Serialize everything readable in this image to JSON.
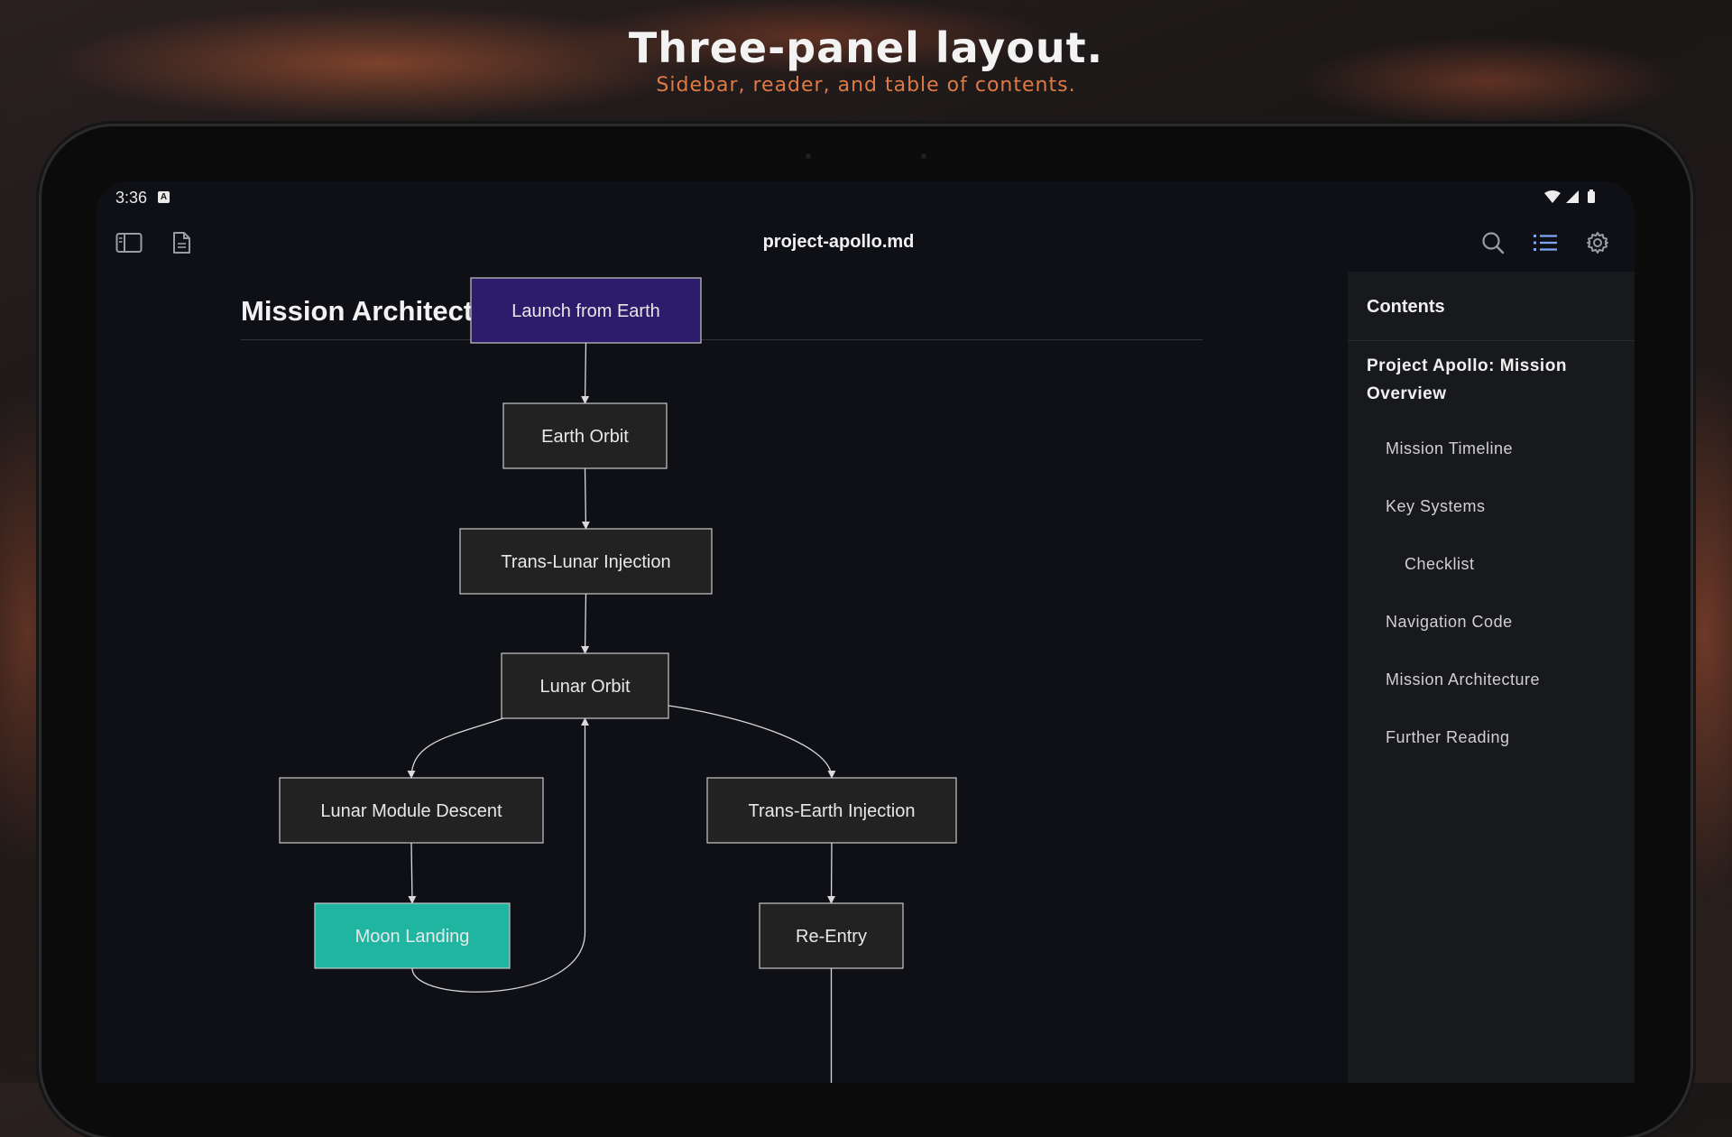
{
  "promo": {
    "title": "Three-panel layout.",
    "subtitle": "Sidebar, reader, and table of contents."
  },
  "status_bar": {
    "time": "3:36",
    "notification_icon": "a-icon",
    "icons": [
      "wifi-icon",
      "signal-icon",
      "battery-icon"
    ]
  },
  "toolbar": {
    "title": "project-apollo.md",
    "left_icons": [
      "sidebar-toggle-icon",
      "document-icon"
    ],
    "right_icons": [
      "search-icon",
      "list-icon",
      "gear-icon"
    ]
  },
  "reader": {
    "section_title": "Mission Architecture",
    "diagram": {
      "nodes": [
        {
          "id": "launch",
          "label": "Launch from Earth",
          "fill": "#2d1b6b"
        },
        {
          "id": "earth_orbit",
          "label": "Earth Orbit",
          "fill": "#222222"
        },
        {
          "id": "tli",
          "label": "Trans-Lunar Injection",
          "fill": "#222222"
        },
        {
          "id": "lunar_orbit",
          "label": "Lunar Orbit",
          "fill": "#222222"
        },
        {
          "id": "lm_descent",
          "label": "Lunar Module Descent",
          "fill": "#222222"
        },
        {
          "id": "tei",
          "label": "Trans-Earth Injection",
          "fill": "#222222"
        },
        {
          "id": "moon_landing",
          "label": "Moon Landing",
          "fill": "#1fb5a0"
        },
        {
          "id": "reentry",
          "label": "Re-Entry",
          "fill": "#222222"
        }
      ],
      "edges": [
        [
          "launch",
          "earth_orbit"
        ],
        [
          "earth_orbit",
          "tli"
        ],
        [
          "tli",
          "lunar_orbit"
        ],
        [
          "lunar_orbit",
          "lm_descent"
        ],
        [
          "lunar_orbit",
          "tei"
        ],
        [
          "lm_descent",
          "moon_landing"
        ],
        [
          "moon_landing",
          "lunar_orbit"
        ],
        [
          "tei",
          "reentry"
        ]
      ]
    }
  },
  "toc": {
    "header": "Contents",
    "main": "Project Apollo: Mission Overview",
    "items": [
      {
        "label": "Mission Timeline",
        "level": 2
      },
      {
        "label": "Key Systems",
        "level": 2
      },
      {
        "label": "Checklist",
        "level": 3
      },
      {
        "label": "Navigation Code",
        "level": 2
      },
      {
        "label": "Mission Architecture",
        "level": 2
      },
      {
        "label": "Further Reading",
        "level": 2
      }
    ]
  },
  "colors": {
    "accent": "#e07a45",
    "screen_bg": "#0f1016",
    "toc_bg": "#18191d"
  }
}
